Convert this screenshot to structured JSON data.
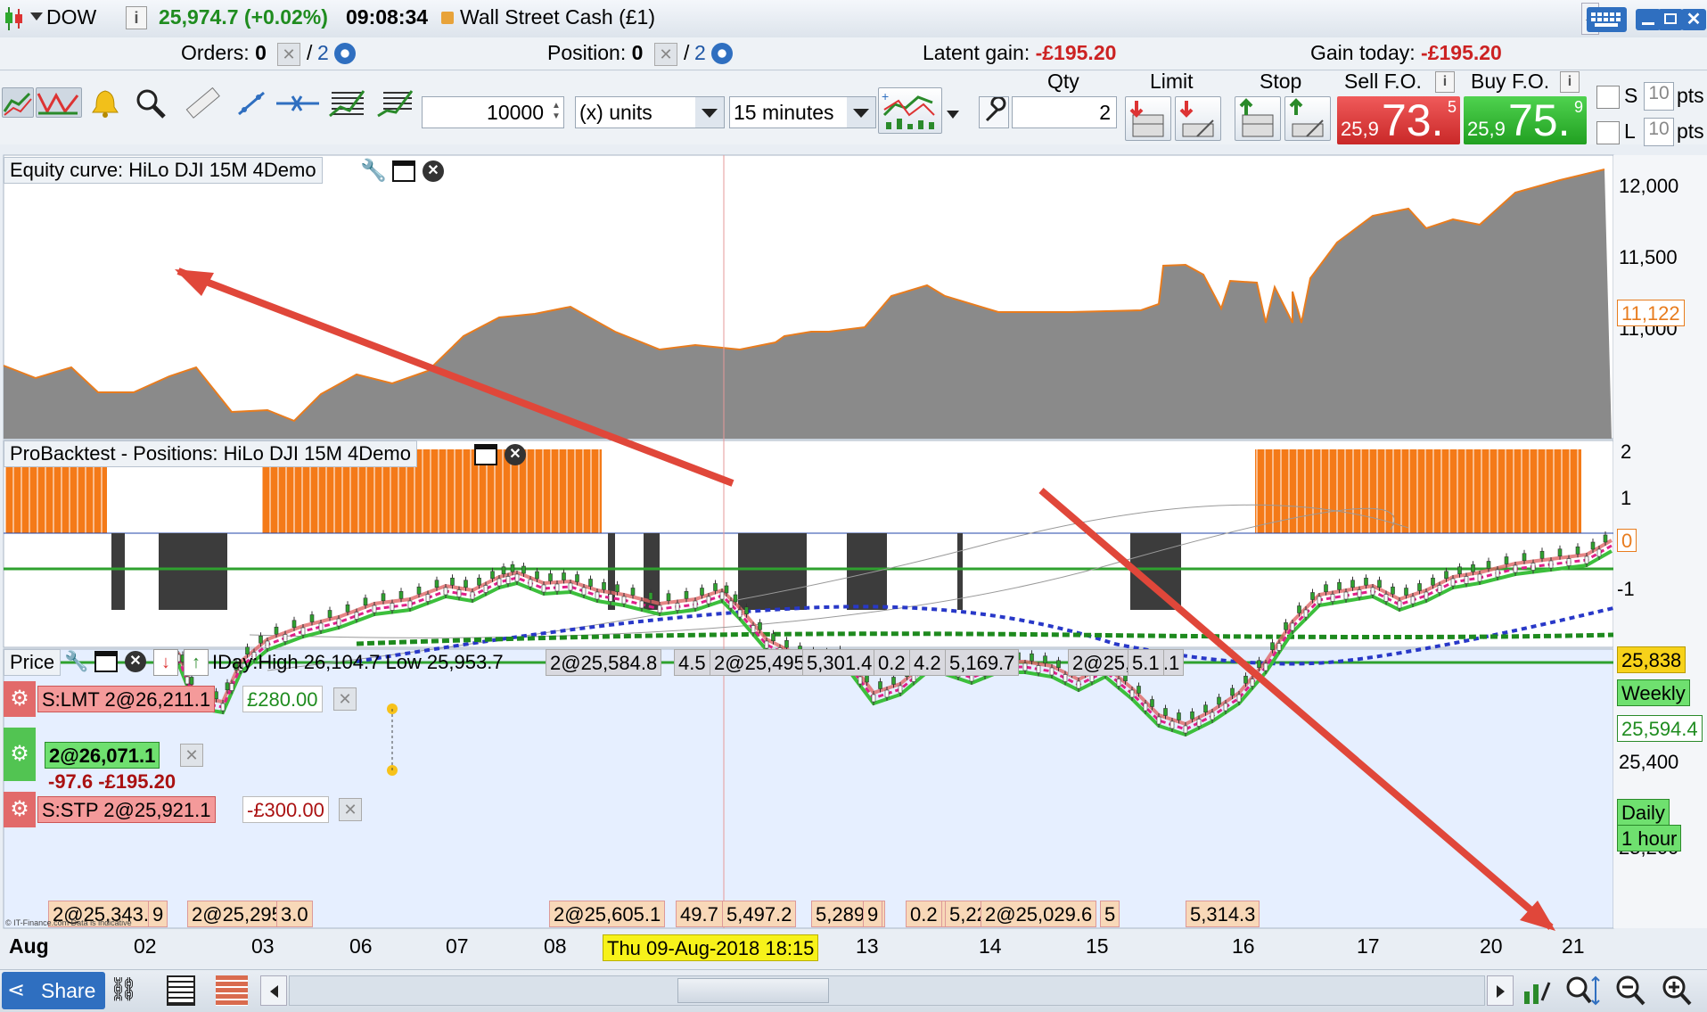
{
  "titlebar": {
    "instrument": "DOW",
    "price": "25,974.7 (+0.02%)",
    "time": "09:08:34",
    "market": "Wall Street Cash (£1)"
  },
  "infobar": {
    "orders_label": "Orders:",
    "orders_value": "0",
    "orders_count": "2",
    "position_label": "Position:",
    "position_value": "0",
    "position_count": "2",
    "latent_label": "Latent gain:",
    "latent_value": "-£195.20",
    "today_label": "Gain today:",
    "today_value": "-£195.20"
  },
  "toolbar": {
    "units_value": "10000",
    "units_type": "(x) units",
    "timeframe": "15 minutes"
  },
  "order_panel": {
    "qty_label": "Qty",
    "qty_value": "2",
    "limit_label": "Limit",
    "stop_label": "Stop",
    "sell_label": "Sell F.O.",
    "buy_label": "Buy F.O.",
    "sell_prefix": "25,9",
    "sell_big": "73.",
    "sell_sup": "5",
    "buy_prefix": "25,9",
    "buy_big": "75.",
    "buy_sup": "9",
    "s_label": "S",
    "s_pts": "10",
    "l_label": "L",
    "l_pts": "10",
    "pts_label": "pts"
  },
  "equity_panel": {
    "title": "Equity curve: HiLo DJI 15M 4Demo",
    "axis": [
      "12,000",
      "11,500",
      "11,000"
    ],
    "current": "11,122",
    "colors": {
      "fill": "#8a8a8a",
      "line": "#e87c1e"
    }
  },
  "positions_panel": {
    "title": "ProBacktest - Positions: HiLo DJI 15M 4Demo",
    "axis": [
      "2",
      "1",
      "0",
      "-1"
    ]
  },
  "price_panel": {
    "title": "Price",
    "indicator_text": "IDay:High 26,104.7 Low 25,953.7",
    "top_labels": [
      "2@25,584.8",
      "4.5",
      "2@25,495.7",
      "5,301.4",
      "0.2",
      "4.2",
      "5,169.7",
      "2@25,206.1",
      "5.1"
    ],
    "bottom_labels": [
      "2@25,343.3",
      "9",
      "2@25,295.2",
      "3.0",
      "2@25,605.1",
      "49.7",
      "5,497.2",
      "5,289.5",
      "9",
      "0.2",
      "0.2",
      "5,228.7",
      "2@25,029.6",
      "5",
      "5,314.3"
    ],
    "limit_order": "S:LMT 2@26,211.1",
    "limit_gain": "£280.00",
    "position_label": "2@26,071.1",
    "position_pl": "-97.6 -£195.20",
    "stop_order": "S:STP 2@25,921.1",
    "stop_loss": "-£300.00",
    "axis_current": "25,838",
    "axis_weekly": "Weekly",
    "axis_594": "25,594.4",
    "axis_400": "25,400",
    "axis_daily": "Daily",
    "axis_hour": "1 hour",
    "axis_200": "25,200",
    "copyright": "© IT-Finance.com Data is indicative"
  },
  "time_axis": {
    "month": "Aug",
    "dates": [
      "02",
      "03",
      "06",
      "07",
      "08",
      "13",
      "14",
      "15",
      "16",
      "17",
      "20",
      "21"
    ],
    "cursor": "Thu 09-Aug-2018 18:15"
  },
  "statusbar": {
    "share_label": "Share"
  },
  "icons": [
    "menu-arrow-icon",
    "info-icon",
    "orders-remove-icon",
    "gear-icon",
    "alert-bell-icon",
    "zoom-search-icon",
    "ruler-icon",
    "line-tool-icon",
    "wrench-icon",
    "window-icon",
    "close-icon",
    "share-icon",
    "zoom-in-icon",
    "zoom-out-icon"
  ]
}
